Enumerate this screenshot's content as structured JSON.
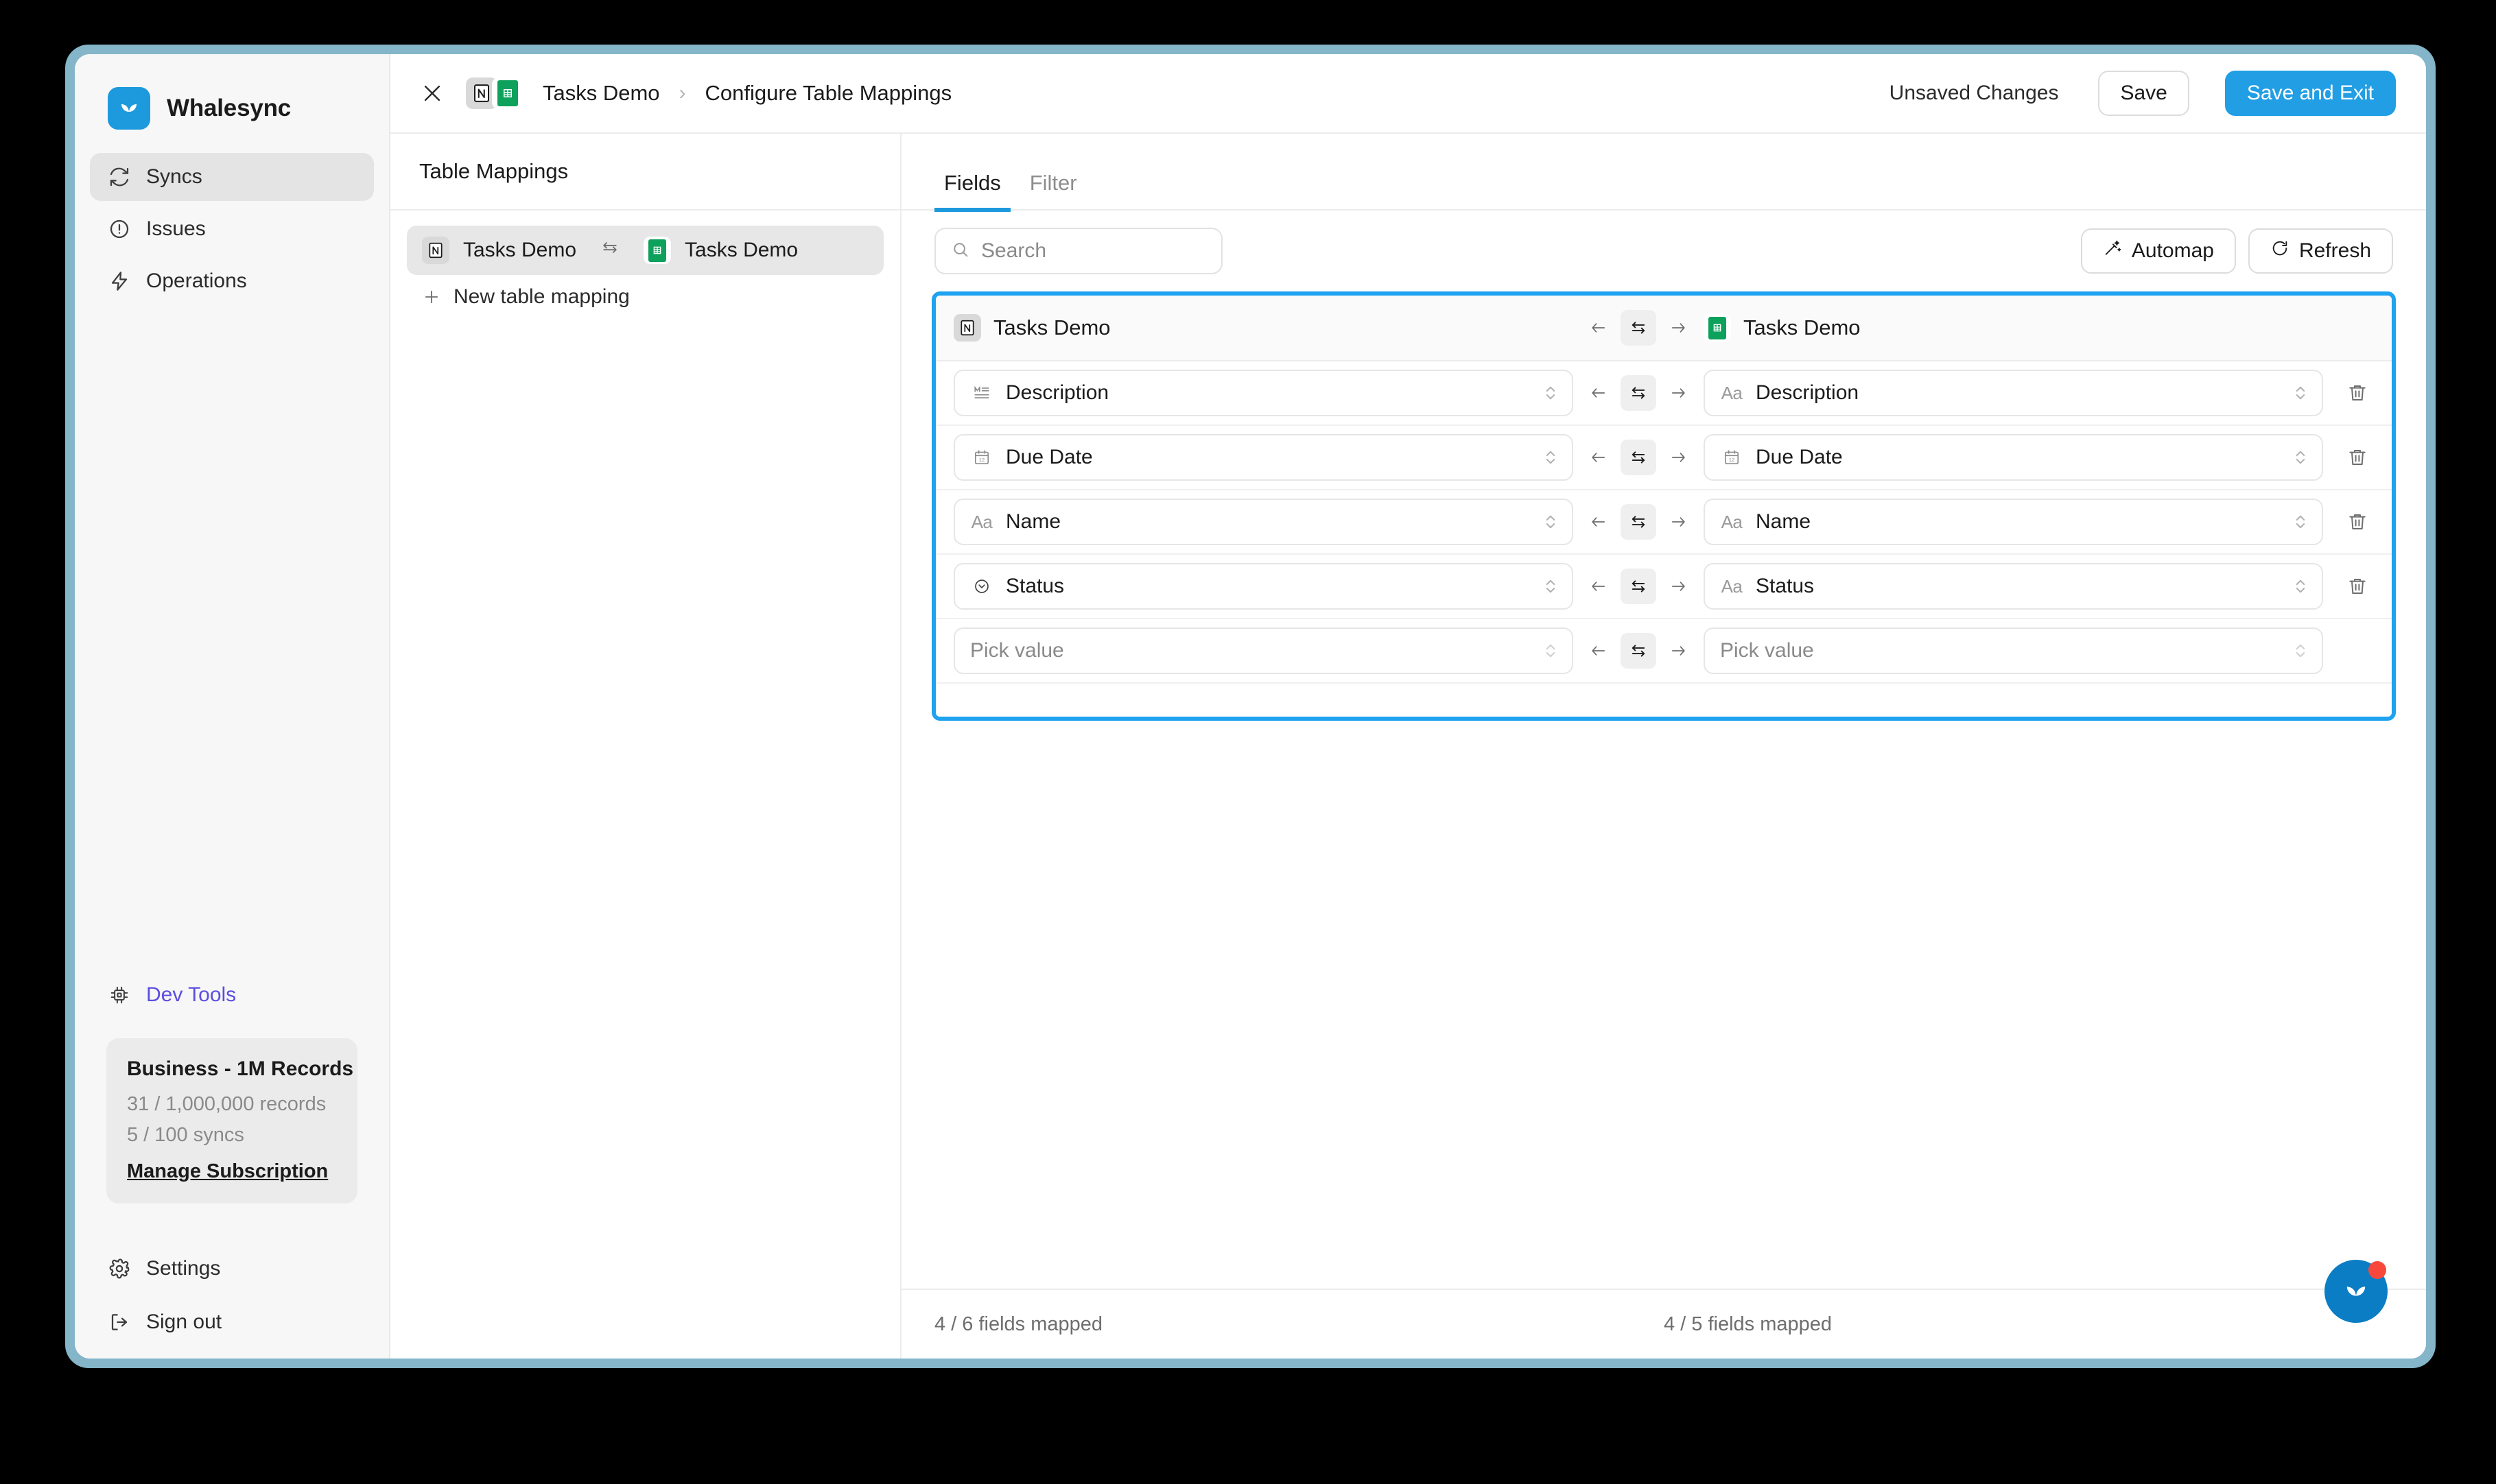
{
  "theme": {
    "accent_blue": "#1d99dd",
    "primary_button": "#219ee4",
    "highlight_border": "#1fa2ef",
    "devtools_purple": "#5b4de0",
    "sheets_green": "#0da15c",
    "notification_red": "#f8483c",
    "window_frame": "#84b5c9"
  },
  "sidebar": {
    "brand": {
      "name": "Whalesync",
      "logo_icon": "whalesync-logo-icon"
    },
    "nav": [
      {
        "label": "Syncs",
        "icon": "sync-icon",
        "active": true
      },
      {
        "label": "Issues",
        "icon": "alert-circle-icon",
        "active": false
      },
      {
        "label": "Operations",
        "icon": "lightning-bolt-icon",
        "active": false
      }
    ],
    "devtools": {
      "label": "Dev Tools",
      "icon": "chip-icon"
    },
    "plan": {
      "title": "Business - 1M Records",
      "records": "31 / 1,000,000 records",
      "syncs": "5 / 100 syncs",
      "manage_link": "Manage Subscription"
    },
    "bottom_nav": [
      {
        "label": "Settings",
        "icon": "gear-icon"
      },
      {
        "label": "Sign out",
        "icon": "sign-out-icon"
      }
    ]
  },
  "topbar": {
    "close_icon": "close-icon",
    "breadcrumb": {
      "source_icon": "notion-icon",
      "destination_icon": "google-sheets-icon",
      "sync_name": "Tasks Demo",
      "separator": "›",
      "page": "Configure Table Mappings"
    },
    "status": "Unsaved Changes",
    "save_label": "Save",
    "save_exit_label": "Save and Exit"
  },
  "mappings_panel": {
    "heading": "Table Mappings",
    "items": [
      {
        "source_icon": "notion-icon",
        "source_label": "Tasks Demo",
        "direction_icon": "bidirectional-icon",
        "destination_icon": "google-sheets-icon",
        "destination_label": "Tasks Demo",
        "selected": true
      }
    ],
    "new_mapping_label": "New table mapping",
    "new_mapping_icon": "plus-icon"
  },
  "fields_panel": {
    "tabs": [
      {
        "label": "Fields",
        "active": true
      },
      {
        "label": "Filter",
        "active": false
      }
    ],
    "search": {
      "placeholder": "Search",
      "value": "",
      "icon": "search-icon"
    },
    "automap_label": "Automap",
    "automap_icon": "magic-wand-icon",
    "refresh_label": "Refresh",
    "refresh_icon": "refresh-icon",
    "table": {
      "header": {
        "source_icon": "notion-icon",
        "source_label": "Tasks Demo",
        "direction": "bidirectional",
        "destination_icon": "google-sheets-icon",
        "destination_label": "Tasks Demo"
      },
      "rows": [
        {
          "source": {
            "label": "Description",
            "type_icon": "rich-text-icon"
          },
          "direction": "bidirectional",
          "destination": {
            "label": "Description",
            "type_icon": "text-icon"
          },
          "deletable": true
        },
        {
          "source": {
            "label": "Due Date",
            "type_icon": "calendar-icon"
          },
          "direction": "bidirectional",
          "destination": {
            "label": "Due Date",
            "type_icon": "calendar-icon"
          },
          "deletable": true
        },
        {
          "source": {
            "label": "Name",
            "type_icon": "text-icon"
          },
          "direction": "bidirectional",
          "destination": {
            "label": "Name",
            "type_icon": "text-icon"
          },
          "deletable": true
        },
        {
          "source": {
            "label": "Status",
            "type_icon": "select-icon"
          },
          "direction": "bidirectional",
          "destination": {
            "label": "Status",
            "type_icon": "text-icon"
          },
          "deletable": true
        },
        {
          "source": {
            "label": "Pick value",
            "type_icon": "none",
            "placeholder": true
          },
          "direction": "bidirectional",
          "destination": {
            "label": "Pick value",
            "type_icon": "none",
            "placeholder": true
          },
          "deletable": false
        }
      ]
    },
    "footer": {
      "source_count": "4 / 6 fields mapped",
      "destination_count": "4 / 5 fields mapped"
    }
  },
  "chat_widget": {
    "icon": "whalesync-chat-icon",
    "has_notification": true
  }
}
